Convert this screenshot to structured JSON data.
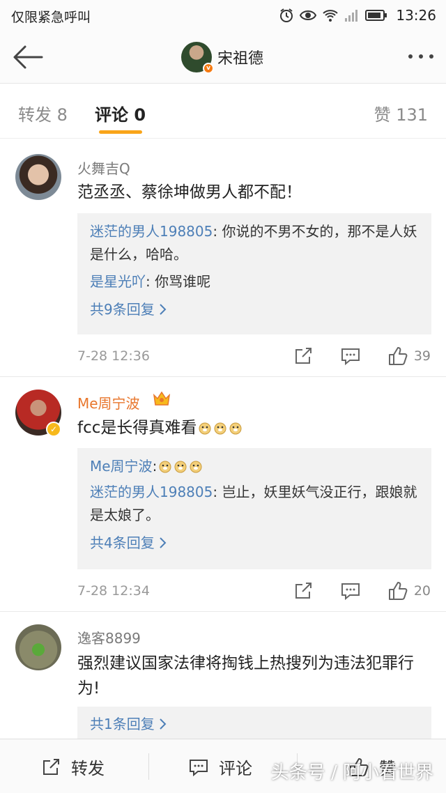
{
  "status_bar": {
    "carrier": "仅限紧急呼叫",
    "time": "13:26",
    "icons": [
      "alarm-icon",
      "eye-icon",
      "wifi-icon",
      "signal-icon",
      "battery-icon"
    ]
  },
  "header": {
    "back_icon": "back-arrow-icon",
    "user_name": "宋祖德",
    "verified_badge": "v",
    "more_icon": "more-dots-icon"
  },
  "tabs": {
    "repost": "转发 8",
    "comments": "评论 0",
    "likes": "赞 131",
    "active_color": "#f9a51a"
  },
  "comments": [
    {
      "name": "火舞吉Q",
      "text": "范丞丞、蔡徐坤做男人都不配！",
      "replies": [
        {
          "name": "迷茫的男人198805",
          "text": ": 你说的不男不女的，那不是人妖是什么，哈哈。"
        },
        {
          "name": "是星光吖",
          "text": ": 你骂谁呢"
        }
      ],
      "reply_count": "共9条回复",
      "time": "7-28 12:36",
      "likes": "39"
    },
    {
      "name": "Me周宁波",
      "text": "fcc是长得真难看",
      "replies": [
        {
          "name": "Me周宁波",
          "text": ":"
        },
        {
          "name": "迷茫的男人198805",
          "text": ": 岂止，妖里妖气没正行，跟娘就是太娘了。"
        }
      ],
      "reply_count": "共4条回复",
      "time": "7-28 12:34",
      "likes": "20"
    },
    {
      "name": "逸客8899",
      "text": "强烈建议国家法律将掏钱上热搜列为违法犯罪行为!",
      "reply_count": "共1条回复"
    }
  ],
  "bottom_bar": {
    "repost": "转发",
    "comment": "评论",
    "like": "赞"
  },
  "watermark": "头条号 / 阿小看世界",
  "colors": {
    "link_blue": "#4d7fb7",
    "vip_orange": "#e8762c",
    "badge_orange": "#f57a12"
  }
}
